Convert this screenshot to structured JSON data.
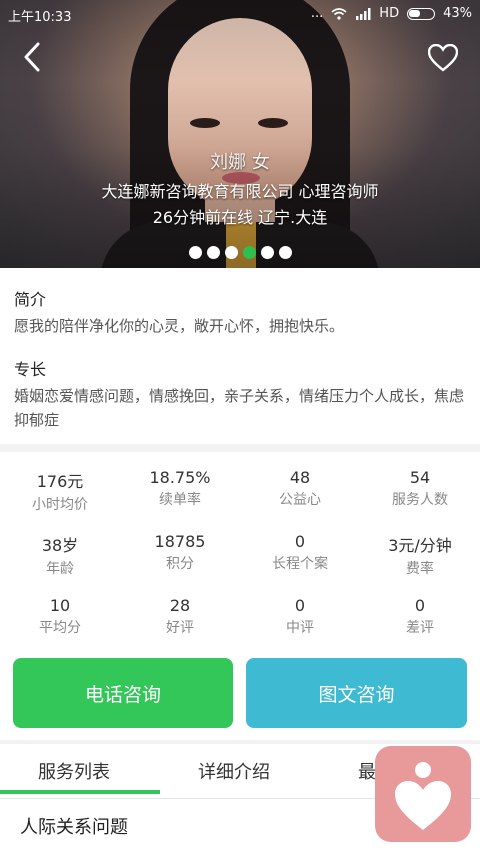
{
  "status": {
    "time": "上午10:33",
    "signal": "...",
    "network": "HD",
    "battery": "43%"
  },
  "profile": {
    "name": "刘娜 女",
    "company": "大连娜新咨询教育有限公司 心理咨询师",
    "online": "26分钟前在线 辽宁.大连",
    "slides": 6,
    "active_slide": 3
  },
  "intro": {
    "title": "简介",
    "text": "愿我的陪伴净化你的心灵，敞开心怀，拥抱快乐。",
    "specialty_title": "专长",
    "specialty_text": "婚姻恋爱情感问题，情感挽回，亲子关系，情绪压力个人成长，焦虑抑郁症"
  },
  "stats": [
    {
      "value": "176元",
      "label": "小时均价"
    },
    {
      "value": "18.75%",
      "label": "续单率"
    },
    {
      "value": "48",
      "label": "公益心"
    },
    {
      "value": "54",
      "label": "服务人数"
    },
    {
      "value": "38岁",
      "label": "年龄"
    },
    {
      "value": "18785",
      "label": "积分"
    },
    {
      "value": "0",
      "label": "长程个案"
    },
    {
      "value": "3元/分钟",
      "label": "费率"
    },
    {
      "value": "10",
      "label": "平均分"
    },
    {
      "value": "28",
      "label": "好评"
    },
    {
      "value": "0",
      "label": "中评"
    },
    {
      "value": "0",
      "label": "差评"
    }
  ],
  "actions": {
    "call": "电话咨询",
    "text": "图文咨询"
  },
  "tabs": [
    "服务列表",
    "详细介绍",
    "最"
  ],
  "service": {
    "title": "人际关系问题"
  },
  "colors": {
    "green": "#33c659",
    "blue": "#3ebad2",
    "pink": "#e89a9a"
  }
}
